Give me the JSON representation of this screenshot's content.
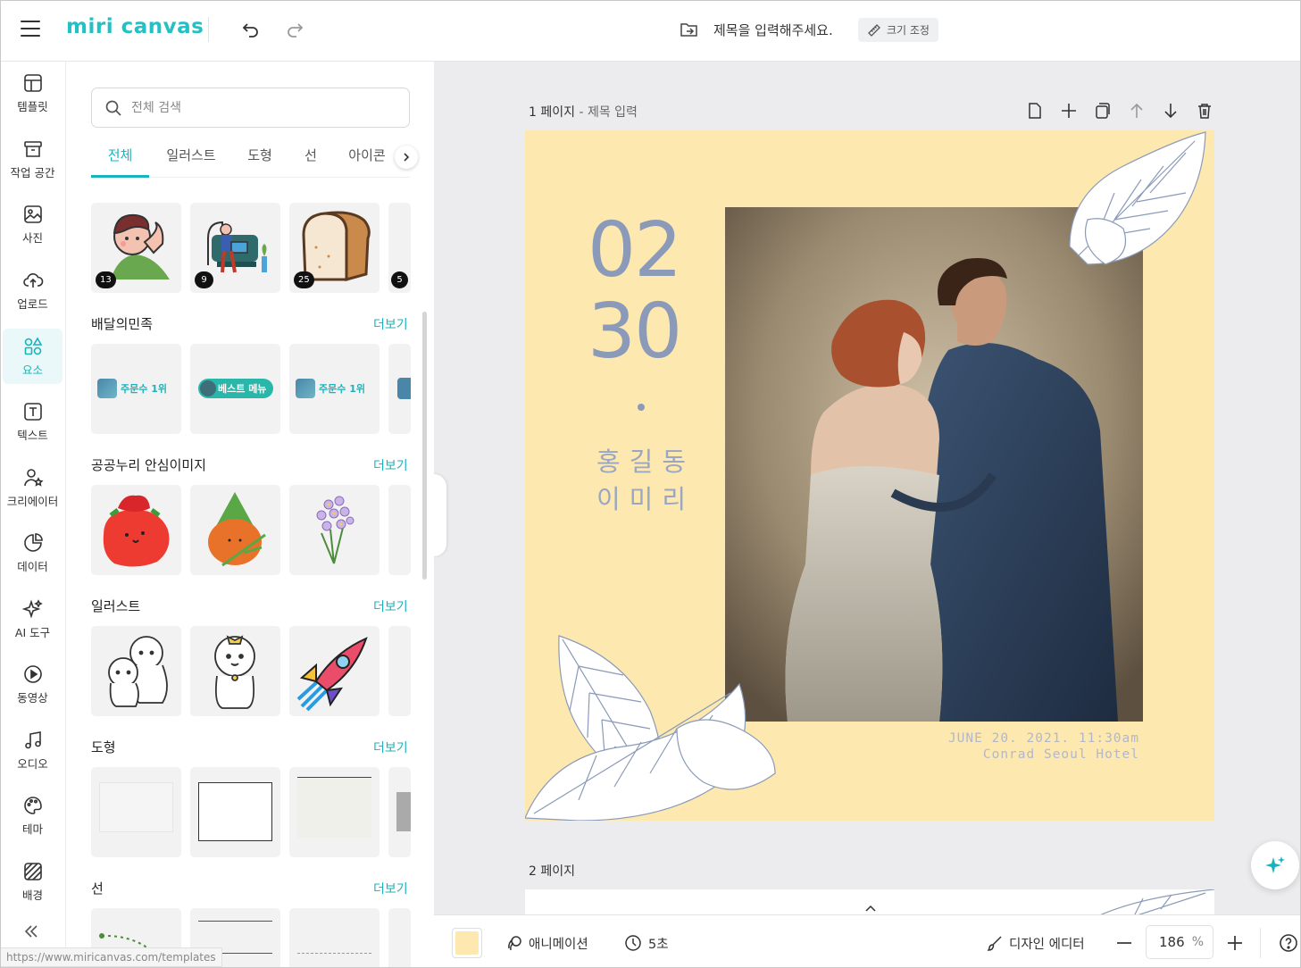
{
  "header": {
    "logo": "miri canvas",
    "document_title": "제목을 입력해주세요.",
    "resize_label": "크기 조정"
  },
  "nav": {
    "items": [
      {
        "label": "템플릿",
        "icon": "template-icon"
      },
      {
        "label": "작업 공간",
        "icon": "archive-icon"
      },
      {
        "label": "사진",
        "icon": "photo-icon"
      },
      {
        "label": "업로드",
        "icon": "upload-icon"
      },
      {
        "label": "요소",
        "icon": "elements-icon",
        "active": true
      },
      {
        "label": "텍스트",
        "icon": "text-icon"
      },
      {
        "label": "크리에이터",
        "icon": "creator-icon"
      },
      {
        "label": "데이터",
        "icon": "chart-icon"
      },
      {
        "label": "AI 도구",
        "icon": "sparkle-icon"
      },
      {
        "label": "동영상",
        "icon": "play-icon"
      },
      {
        "label": "오디오",
        "icon": "music-icon"
      },
      {
        "label": "테마",
        "icon": "palette-icon"
      },
      {
        "label": "배경",
        "icon": "background-icon"
      }
    ],
    "status_url": "https://www.miricanvas.com/templates"
  },
  "panel": {
    "search_placeholder": "전체 검색",
    "tabs": [
      "전체",
      "일러스트",
      "도형",
      "선",
      "아이콘"
    ],
    "active_tab": "전체",
    "top_badges": [
      "13",
      "9",
      "25",
      "5"
    ],
    "sections": [
      {
        "title": "배달의민족",
        "more": "더보기",
        "items": [
          "주문수 1위",
          "베스트 메뉴",
          "주문수 1위"
        ]
      },
      {
        "title": "공공누리 안심이미지",
        "more": "더보기"
      },
      {
        "title": "일러스트",
        "more": "더보기"
      },
      {
        "title": "도형",
        "more": "더보기"
      },
      {
        "title": "선",
        "more": "더보기"
      }
    ]
  },
  "canvas": {
    "page1_label": "1 페이지",
    "page1_separator": " - ",
    "page1_title": "제목 입력",
    "page2_label": "2 페이지",
    "design": {
      "month": "02",
      "day": "30",
      "name1": "홍길동",
      "name2": "이미리",
      "venue_line1": "JUNE 20. 2021. 11:30am",
      "venue_line2": "Conrad Seoul Hotel",
      "background_color": "#fde8b0"
    }
  },
  "bottom_bar": {
    "animation_label": "애니메이션",
    "duration_label": "5초",
    "design_editor_label": "디자인 에디터",
    "zoom_value": "186",
    "zoom_unit": "%"
  },
  "colors": {
    "accent": "#1bb3bb",
    "page_bg": "#fde8b0",
    "date_text": "#8a9ab8"
  }
}
